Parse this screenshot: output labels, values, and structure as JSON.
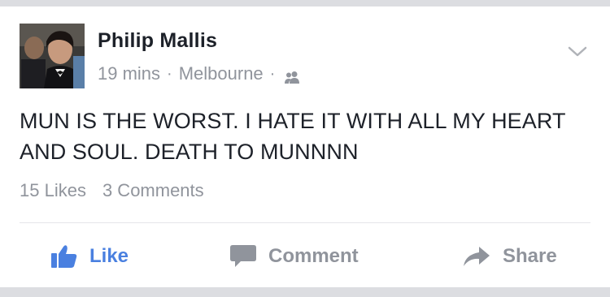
{
  "post": {
    "author_name": "Philip Mallis",
    "time": "19 mins",
    "separator": "·",
    "location": "Melbourne",
    "audience_icon": "friends-icon",
    "text_line1": "MUN IS THE WORST. I HATE IT WITH ALL MY HEART",
    "text_line2": "AND SOUL.  DEATH TO MUNNNN",
    "likes": "15 Likes",
    "comments": "3 Comments"
  },
  "actions": {
    "like": "Like",
    "comment": "Comment",
    "share": "Share"
  },
  "colors": {
    "like_blue": "#4a80e0",
    "meta_gray": "#90949c",
    "text_dark": "#1d2129",
    "bg_gray": "#dcdde1"
  }
}
